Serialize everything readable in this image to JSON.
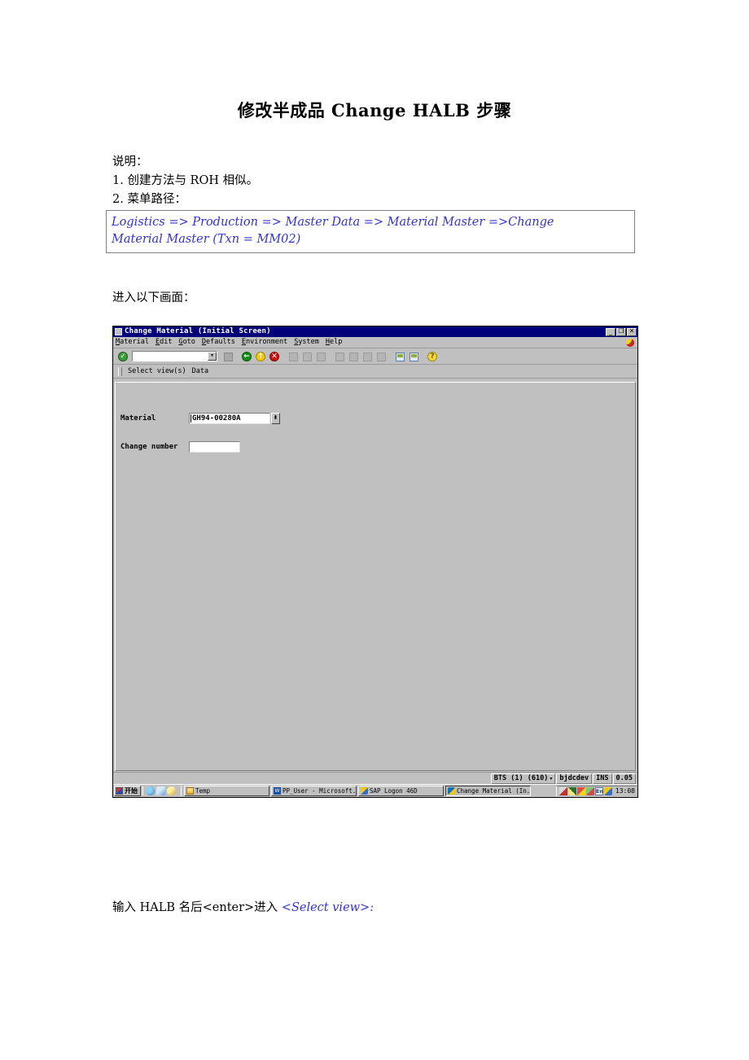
{
  "document": {
    "title": "修改半成品 Change HALB 步骤",
    "note_label": "说明：",
    "item1": "1. 创建方法与 ROH 相似。",
    "item2": "2. 菜单路径：",
    "menu_path_line1": "Logistics => Production => Master Data => Material Master =>Change",
    "menu_path_line2": "Material Master (Txn = MM02)",
    "screen_intro": "进入以下画面：",
    "enter_prefix": "输入 HALB 名后<enter>进入 ",
    "enter_highlight": "<Select view>:",
    "accent_color": "#3333cc"
  },
  "sap": {
    "window": {
      "title": "Change Material (Initial Screen)",
      "minimize_glyph": "_",
      "restore_glyph": "❐",
      "close_glyph": "✕",
      "titlebar_color": "#00007b"
    },
    "menubar": [
      {
        "pre": "",
        "mnemonic": "M",
        "post": "aterial"
      },
      {
        "pre": "",
        "mnemonic": "E",
        "post": "dit"
      },
      {
        "pre": "",
        "mnemonic": "G",
        "post": "oto"
      },
      {
        "pre": "",
        "mnemonic": "D",
        "post": "efaults"
      },
      {
        "pre": "",
        "mnemonic": "E",
        "post": "nvironment"
      },
      {
        "pre": "",
        "mnemonic": "S",
        "post": "ystem"
      },
      {
        "pre": "",
        "mnemonic": "H",
        "post": "elp"
      }
    ],
    "toolbar": {
      "enter_icon": "enter-check-icon",
      "command_field_value": "",
      "command_field_placeholder": "",
      "dropdown_glyph": "▾",
      "save_icon": "save-disk-icon",
      "back_icon": "back-green-arrow-icon",
      "exit_icon": "exit-yellow-arrow-icon",
      "cancel_icon": "cancel-red-x-icon",
      "print_icon": "print-icon",
      "find_icon": "find-icon",
      "find_next_icon": "find-next-icon",
      "first_page_icon": "first-page-icon",
      "previous_page_icon": "previous-page-icon",
      "next_page_icon": "next-page-icon",
      "last_page_icon": "last-page-icon",
      "create_session_icon": "create-session-icon",
      "create_shortcut_icon": "create-shortcut-icon",
      "help_icon": "help-question-icon"
    },
    "app_functions": [
      {
        "label": "Select view(s)"
      },
      {
        "label": "Data"
      }
    ],
    "fields": [
      {
        "label": "Material",
        "value": "GH94-00280A",
        "has_matchcode": true,
        "matchcode_glyph": "⬍"
      },
      {
        "label": "Change number",
        "value": "",
        "has_matchcode": false
      }
    ],
    "statusbar": {
      "system": "BTS (1) (610)",
      "system_drop_glyph": "▾",
      "server": "bjdcdev",
      "insert_mode": "INS",
      "response_time": "0.05"
    }
  },
  "taskbar": {
    "start_label": "开始",
    "quick_launch": [
      {
        "name": "internet-explorer-icon"
      },
      {
        "name": "show-desktop-icon"
      },
      {
        "name": "outlook-express-icon"
      }
    ],
    "tasks": [
      {
        "label": "Temp",
        "icon": "folder-icon",
        "active": false
      },
      {
        "label": "PP_User - Microsoft...",
        "icon": "word-icon",
        "active": false
      },
      {
        "label": "SAP Logon 46D",
        "icon": "sap-logon-icon",
        "active": false
      },
      {
        "label": "Change Material (In...",
        "icon": "sap-gui-icon",
        "active": true
      }
    ],
    "tray": [
      {
        "name": "tray-icon-1"
      },
      {
        "name": "tray-icon-2"
      },
      {
        "name": "tray-icon-3"
      },
      {
        "name": "tray-icon-4"
      },
      {
        "name": "language-indicator",
        "label": "En"
      },
      {
        "name": "tray-icon-5"
      }
    ],
    "clock": "13:08"
  }
}
